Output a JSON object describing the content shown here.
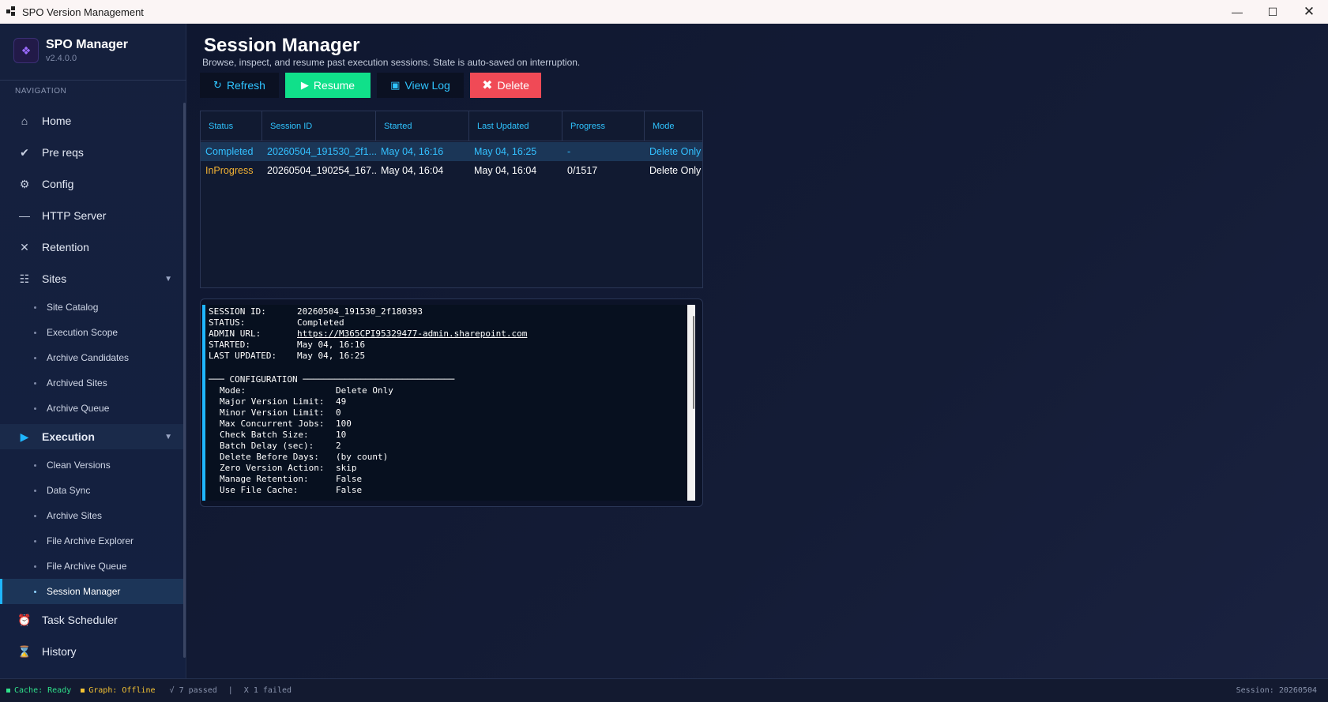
{
  "window": {
    "title": "SPO Version Management"
  },
  "brand": {
    "name": "SPO Manager",
    "version": "v2.4.0.0",
    "logo_icon": "diamond-icon"
  },
  "sidebar": {
    "heading": "NAVIGATION",
    "items": [
      {
        "label": "Home",
        "icon": "home-icon"
      },
      {
        "label": "Pre reqs",
        "icon": "check-icon"
      },
      {
        "label": "Config",
        "icon": "gear-icon"
      },
      {
        "label": "HTTP Server",
        "icon": "dash-icon"
      },
      {
        "label": "Retention",
        "icon": "close-icon"
      },
      {
        "label": "Sites",
        "icon": "list-icon",
        "expanded": true
      },
      {
        "label": "Execution",
        "icon": "play-icon",
        "expanded": true
      },
      {
        "label": "Task Scheduler",
        "icon": "alarm-icon"
      },
      {
        "label": "History",
        "icon": "hourglass-icon"
      }
    ],
    "sites_children": [
      "Site Catalog",
      "Execution Scope",
      "Archive Candidates",
      "Archived Sites",
      "Archive Queue"
    ],
    "execution_children": [
      "Clean Versions",
      "Data Sync",
      "Archive Sites",
      "File Archive Explorer",
      "File Archive Queue",
      "Session Manager"
    ],
    "active_item": "Session Manager"
  },
  "page": {
    "title": "Session Manager",
    "subtitle": "Browse, inspect, and resume past execution sessions. State is auto-saved on interruption."
  },
  "toolbar": {
    "refresh": "Refresh",
    "resume": "Resume",
    "view_log": "View Log",
    "delete": "Delete"
  },
  "table": {
    "columns": [
      "Status",
      "Session ID",
      "Started",
      "Last Updated",
      "Progress",
      "Mode"
    ],
    "rows": [
      {
        "status": "Completed",
        "session_id": "20260504_191530_2f1...",
        "started": "May 04, 16:16",
        "last_updated": "May 04, 16:25",
        "progress": "-",
        "mode": "Delete Only",
        "selected": true
      },
      {
        "status": "InProgress",
        "session_id": "20260504_190254_167...",
        "started": "May 04, 16:04",
        "last_updated": "May 04, 16:04",
        "progress": "0/1517",
        "mode": "Delete Only",
        "selected": false
      }
    ]
  },
  "detail": {
    "header": [
      {
        "key": "SESSION ID:",
        "value": "20260504_191530_2f180393"
      },
      {
        "key": "STATUS:",
        "value": "Completed"
      },
      {
        "key": "ADMIN URL:",
        "value": "https://M365CPI95329477-admin.sharepoint.com"
      },
      {
        "key": "STARTED:",
        "value": "May 04, 16:16"
      },
      {
        "key": "LAST UPDATED:",
        "value": "May 04, 16:25"
      }
    ],
    "config_heading": "─── CONFIGURATION ─────────────────────────────",
    "config": [
      {
        "key": "Mode:",
        "value": "Delete Only"
      },
      {
        "key": "Major Version Limit:",
        "value": "49"
      },
      {
        "key": "Minor Version Limit:",
        "value": "0"
      },
      {
        "key": "Max Concurrent Jobs:",
        "value": "100"
      },
      {
        "key": "Check Batch Size:",
        "value": "10"
      },
      {
        "key": "Batch Delay (sec):",
        "value": "2"
      },
      {
        "key": "Delete Before Days:",
        "value": "(by count)"
      },
      {
        "key": "Zero Version Action:",
        "value": "skip"
      },
      {
        "key": "Manage Retention:",
        "value": "False"
      },
      {
        "key": "Use File Cache:",
        "value": "False"
      }
    ]
  },
  "statusbar": {
    "cache": "Cache: Ready",
    "graph": "Graph: Offline",
    "passed": "√ 7 passed",
    "sep": "|",
    "failed": "X 1 failed",
    "session": "Session: 20260504"
  },
  "colors": {
    "accent": "#1fb6ff",
    "completed": "#33c0ff",
    "inprogress": "#f3b233",
    "resume_button": "#10e08a",
    "delete_button": "#f04a56"
  }
}
